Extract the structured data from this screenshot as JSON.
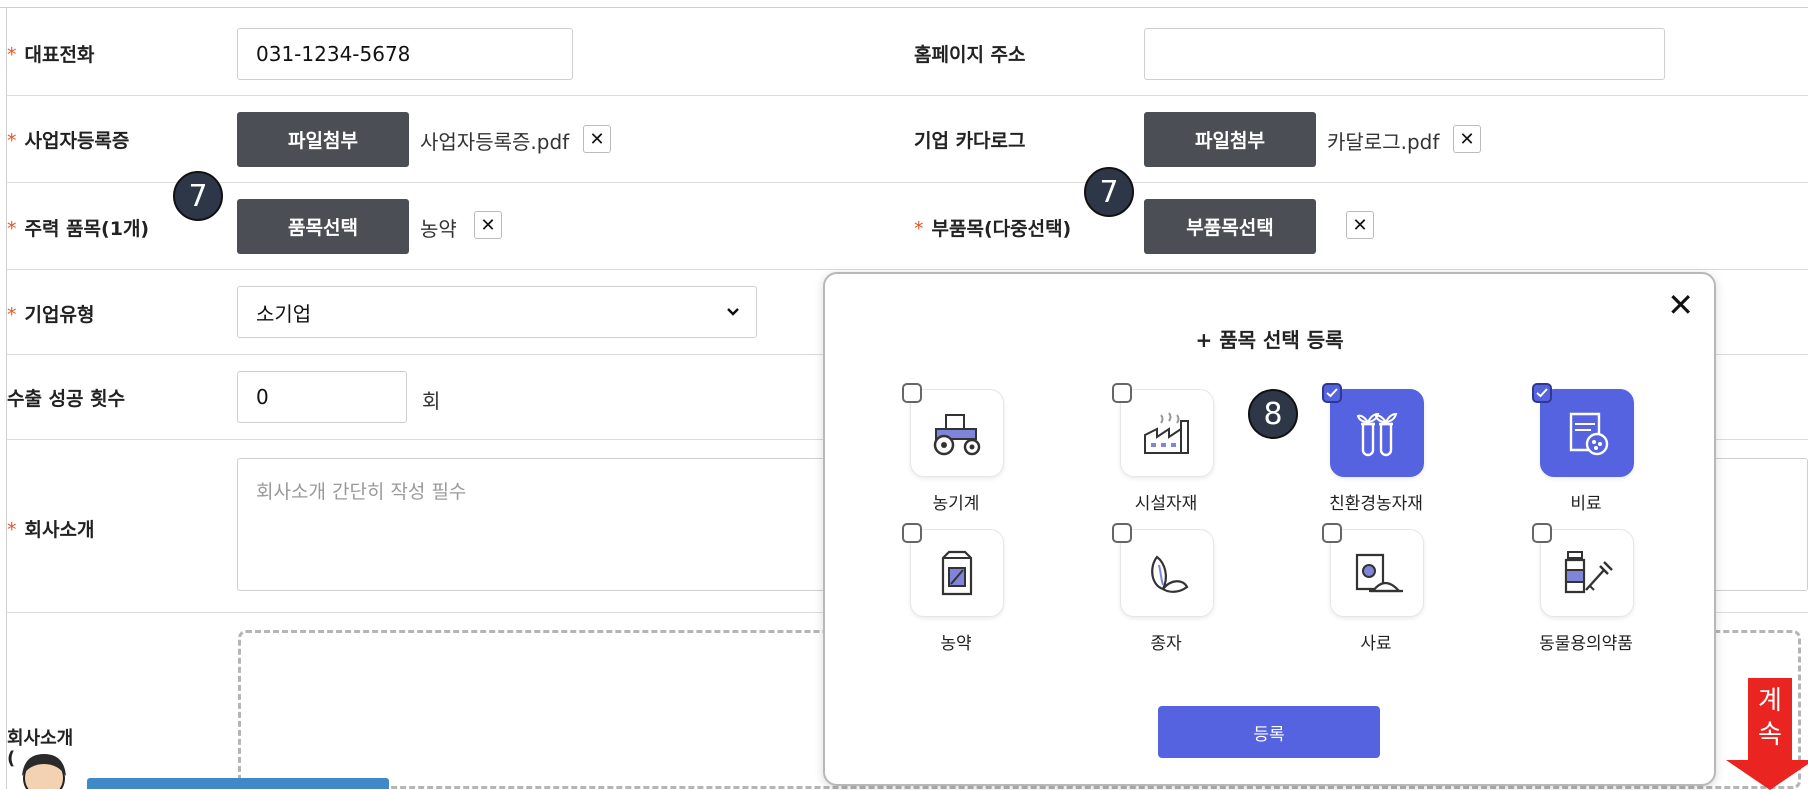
{
  "form": {
    "phone": {
      "label": "대표전화",
      "value": "031-1234-5678"
    },
    "homepage": {
      "label": "홈페이지 주소",
      "value": ""
    },
    "business_reg": {
      "label": "사업자등록증",
      "button": "파일첨부",
      "file": "사업자등록증.pdf"
    },
    "catalog": {
      "label": "기업 카다로그",
      "button": "파일첨부",
      "file": "카달로그.pdf"
    },
    "main_item": {
      "label": "주력 품목(1개)",
      "button": "품목선택",
      "selected": "농약",
      "badge": "7"
    },
    "sub_item": {
      "label": "부품목(다중선택)",
      "button": "부품목선택",
      "badge": "7"
    },
    "company_type": {
      "label": "기업유형",
      "value": "소기업"
    },
    "export_count": {
      "label": "수출 성공 횟수",
      "value": "0",
      "unit": "회"
    },
    "intro": {
      "label": "회사소개",
      "placeholder": "회사소개 간단히 작성 필수"
    },
    "intro_file": {
      "label": "회사소개",
      "label_line2": "("
    },
    "required_mark": "*",
    "remove_mark": "✕"
  },
  "modal": {
    "title": "+ 품목 선택 등록",
    "close": "✕",
    "badge": "8",
    "items": [
      {
        "label": "농기계",
        "icon": "tractor-icon",
        "checked": false
      },
      {
        "label": "시설자재",
        "icon": "factory-icon",
        "checked": false
      },
      {
        "label": "친환경농자재",
        "icon": "seedling-tubes-icon",
        "checked": true
      },
      {
        "label": "비료",
        "icon": "fertilizer-bag-icon",
        "checked": true
      },
      {
        "label": "농약",
        "icon": "pesticide-pack-icon",
        "checked": false
      },
      {
        "label": "종자",
        "icon": "seed-icon",
        "checked": false
      },
      {
        "label": "사료",
        "icon": "feed-icon",
        "checked": false
      },
      {
        "label": "동물용의약품",
        "icon": "veterinary-medicine-icon",
        "checked": false
      }
    ],
    "register": "등록"
  },
  "continue": {
    "line1": "계",
    "line2": "속"
  },
  "colors": {
    "accent": "#5663e0",
    "dark_button": "#4b4f55",
    "required": "#e2572b",
    "continue": "#ea2420"
  }
}
